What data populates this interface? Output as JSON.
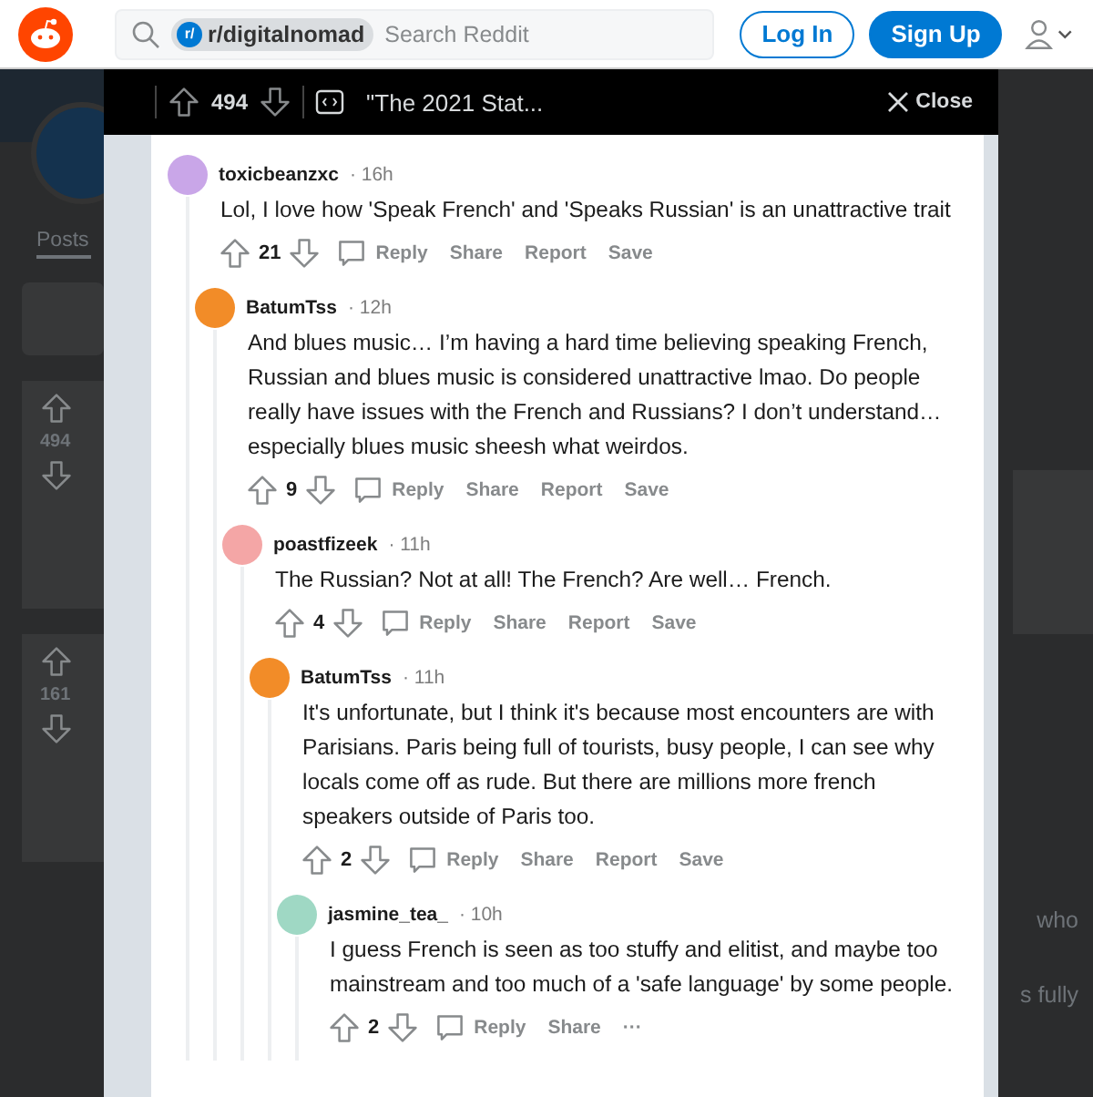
{
  "header": {
    "community": "r/digitalnomad",
    "community_icon": "r/",
    "search_placeholder": "Search Reddit",
    "login": "Log In",
    "signup": "Sign Up"
  },
  "background": {
    "left": {
      "tab": "Posts",
      "posts": [
        {
          "score": "494"
        },
        {
          "score": "161"
        }
      ]
    },
    "right": {
      "fragments": [
        "who",
        "s fully"
      ]
    }
  },
  "modal": {
    "score": "494",
    "title": "\"The 2021 Stat...",
    "close": "Close",
    "comments": [
      {
        "user": "toxicbeanzxc",
        "time": "· 16h",
        "color": "#c9a6e8",
        "text": "Lol, I love how 'Speak French' and 'Speaks Russian' is an unattractive trait",
        "score": "21",
        "actions": [
          "Reply",
          "Share",
          "Report",
          "Save"
        ],
        "children": [
          {
            "user": "BatumTss",
            "time": "· 12h",
            "color": "#f28c28",
            "text": "And blues music… I’m having a hard time believing speaking French, Russian and blues music is considered unattractive lmao. Do people really have issues with the French and Russians? I don’t understand… especially blues music sheesh what weirdos.",
            "score": "9",
            "actions": [
              "Reply",
              "Share",
              "Report",
              "Save"
            ],
            "children": [
              {
                "user": "poastfizeek",
                "time": "· 11h",
                "color": "#f4a6a6",
                "text": "The Russian? Not at all! The French? Are well… French.",
                "score": "4",
                "actions": [
                  "Reply",
                  "Share",
                  "Report",
                  "Save"
                ],
                "children": [
                  {
                    "user": "BatumTss",
                    "time": "· 11h",
                    "color": "#f28c28",
                    "text": "It's unfortunate, but I think it's because most encounters are with Parisians. Paris being full of tourists, busy people, I can see why locals come off as rude. But there are millions more french speakers outside of Paris too.",
                    "score": "2",
                    "actions": [
                      "Reply",
                      "Share",
                      "Report",
                      "Save"
                    ],
                    "children": [
                      {
                        "user": "jasmine_tea_",
                        "time": "· 10h",
                        "color": "#9fd8c4",
                        "text": "I guess French is seen as too stuffy and elitist, and maybe too mainstream and too much of a 'safe language' by some people.",
                        "score": "2",
                        "actions": [
                          "Reply",
                          "Share",
                          "···"
                        ]
                      }
                    ]
                  }
                ]
              }
            ]
          }
        ]
      }
    ]
  }
}
